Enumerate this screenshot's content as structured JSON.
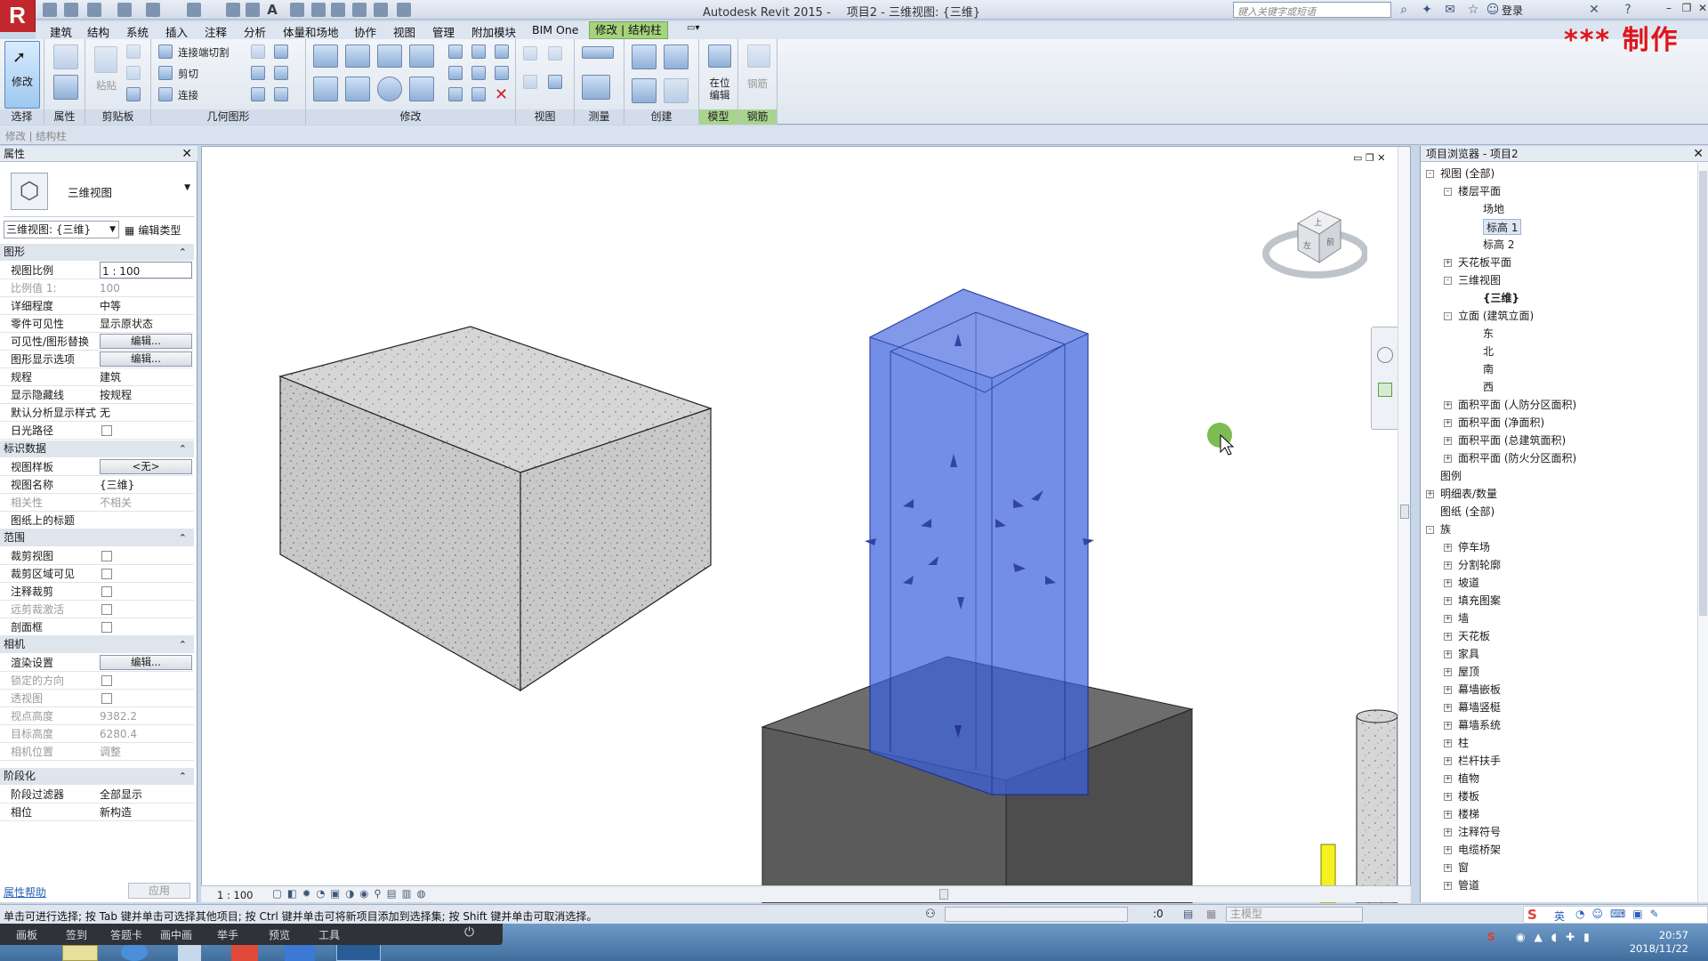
{
  "window": {
    "app_title": "Autodesk Revit 2015 -",
    "doc_title": "项目2 - 三维视图: {三维}",
    "search_placeholder": "键入关键字或短语",
    "login": "登录",
    "watermark": "*** 制作"
  },
  "menu": [
    "建筑",
    "结构",
    "系统",
    "插入",
    "注释",
    "分析",
    "体量和场地",
    "协作",
    "视图",
    "管理",
    "附加模块",
    "BIM One",
    "修改 | 结构柱"
  ],
  "ribbon": {
    "modify_label": "修改",
    "paste_label": "粘贴",
    "join_cut": "连接端切割",
    "cut": "剪切",
    "join": "连接",
    "inplace_label": "在位\n编辑",
    "rebar_label": "钢筋",
    "panels": [
      "选择",
      "属性",
      "剪贴板",
      "几何图形",
      "修改",
      "视图",
      "测量",
      "创建",
      "模型",
      "钢筋"
    ]
  },
  "optbar": "修改 | 结构柱",
  "properties": {
    "title": "属性",
    "type_name": "三维视图",
    "selector": "三维视图: {三维}",
    "edit_type": "编辑类型",
    "sections": {
      "graphics": "图形",
      "identity": "标识数据",
      "extents": "范围",
      "camera": "相机",
      "phasing": "阶段化"
    },
    "graphics_rows": [
      {
        "k": "视图比例",
        "v": "1 : 100"
      },
      {
        "k": "比例值 1:",
        "v": "100"
      },
      {
        "k": "详细程度",
        "v": "中等"
      },
      {
        "k": "零件可见性",
        "v": "显示原状态"
      },
      {
        "k": "可见性/图形替换",
        "v": "编辑..."
      },
      {
        "k": "图形显示选项",
        "v": "编辑..."
      },
      {
        "k": "规程",
        "v": "建筑"
      },
      {
        "k": "显示隐藏线",
        "v": "按规程"
      },
      {
        "k": "默认分析显示样式",
        "v": "无"
      },
      {
        "k": "日光路径",
        "v": ""
      }
    ],
    "identity_rows": [
      {
        "k": "视图样板",
        "v": "<无>"
      },
      {
        "k": "视图名称",
        "v": "{三维}"
      },
      {
        "k": "相关性",
        "v": "不相关"
      },
      {
        "k": "图纸上的标题",
        "v": ""
      }
    ],
    "extents_rows": [
      {
        "k": "裁剪视图",
        "v": ""
      },
      {
        "k": "裁剪区域可见",
        "v": ""
      },
      {
        "k": "注释裁剪",
        "v": ""
      },
      {
        "k": "远剪裁激活",
        "v": ""
      },
      {
        "k": "剖面框",
        "v": ""
      }
    ],
    "camera_rows": [
      {
        "k": "渲染设置",
        "v": "编辑..."
      },
      {
        "k": "锁定的方向",
        "v": ""
      },
      {
        "k": "透视图",
        "v": ""
      },
      {
        "k": "视点高度",
        "v": "9382.2"
      },
      {
        "k": "目标高度",
        "v": "6280.4"
      },
      {
        "k": "相机位置",
        "v": "调整"
      }
    ],
    "phasing_rows": [
      {
        "k": "阶段过滤器",
        "v": "全部显示"
      },
      {
        "k": "相位",
        "v": "新构造"
      }
    ],
    "help": "属性帮助",
    "apply": "应用"
  },
  "viewbar": {
    "scale": "1 : 100"
  },
  "viewcube": {
    "front": "前",
    "left": "左",
    "top": "上"
  },
  "browser": {
    "title": "项目浏览器 - 项目2",
    "items": [
      {
        "t": "视图 (全部)",
        "lvl": 0,
        "tog": "-"
      },
      {
        "t": "楼层平面",
        "lvl": 1,
        "tog": "-"
      },
      {
        "t": "场地",
        "lvl": 2,
        "tog": ""
      },
      {
        "t": "标高 1",
        "lvl": 2,
        "tog": "",
        "sel": true
      },
      {
        "t": "标高 2",
        "lvl": 2,
        "tog": ""
      },
      {
        "t": "天花板平面",
        "lvl": 1,
        "tog": "+"
      },
      {
        "t": "三维视图",
        "lvl": 1,
        "tog": "-"
      },
      {
        "t": "{三维}",
        "lvl": 2,
        "tog": "",
        "bold": true
      },
      {
        "t": "立面 (建筑立面)",
        "lvl": 1,
        "tog": "-"
      },
      {
        "t": "东",
        "lvl": 2,
        "tog": ""
      },
      {
        "t": "北",
        "lvl": 2,
        "tog": ""
      },
      {
        "t": "南",
        "lvl": 2,
        "tog": ""
      },
      {
        "t": "西",
        "lvl": 2,
        "tog": ""
      },
      {
        "t": "面积平面 (人防分区面积)",
        "lvl": 1,
        "tog": "+"
      },
      {
        "t": "面积平面 (净面积)",
        "lvl": 1,
        "tog": "+"
      },
      {
        "t": "面积平面 (总建筑面积)",
        "lvl": 1,
        "tog": "+"
      },
      {
        "t": "面积平面 (防火分区面积)",
        "lvl": 1,
        "tog": "+"
      },
      {
        "t": "图例",
        "lvl": 0,
        "tog": ""
      },
      {
        "t": "明细表/数量",
        "lvl": 0,
        "tog": "+"
      },
      {
        "t": "图纸 (全部)",
        "lvl": 0,
        "tog": ""
      },
      {
        "t": "族",
        "lvl": 0,
        "tog": "-"
      },
      {
        "t": "停车场",
        "lvl": 1,
        "tog": "+"
      },
      {
        "t": "分割轮廓",
        "lvl": 1,
        "tog": "+"
      },
      {
        "t": "坡道",
        "lvl": 1,
        "tog": "+"
      },
      {
        "t": "填充图案",
        "lvl": 1,
        "tog": "+"
      },
      {
        "t": "墙",
        "lvl": 1,
        "tog": "+"
      },
      {
        "t": "天花板",
        "lvl": 1,
        "tog": "+"
      },
      {
        "t": "家具",
        "lvl": 1,
        "tog": "+"
      },
      {
        "t": "屋顶",
        "lvl": 1,
        "tog": "+"
      },
      {
        "t": "幕墙嵌板",
        "lvl": 1,
        "tog": "+"
      },
      {
        "t": "幕墙竖梃",
        "lvl": 1,
        "tog": "+"
      },
      {
        "t": "幕墙系统",
        "lvl": 1,
        "tog": "+"
      },
      {
        "t": "柱",
        "lvl": 1,
        "tog": "+"
      },
      {
        "t": "栏杆扶手",
        "lvl": 1,
        "tog": "+"
      },
      {
        "t": "植物",
        "lvl": 1,
        "tog": "+"
      },
      {
        "t": "楼板",
        "lvl": 1,
        "tog": "+"
      },
      {
        "t": "楼梯",
        "lvl": 1,
        "tog": "+"
      },
      {
        "t": "注释符号",
        "lvl": 1,
        "tog": "+"
      },
      {
        "t": "电缆桥架",
        "lvl": 1,
        "tog": "+"
      },
      {
        "t": "窗",
        "lvl": 1,
        "tog": "+"
      },
      {
        "t": "管道",
        "lvl": 1,
        "tog": "+"
      }
    ]
  },
  "status": {
    "text": "单击可进行选择; 按 Tab 键并单击可选择其他项目; 按 Ctrl 键并单击可将新项目添加到选择集; 按 Shift 键并单击可取消选择。",
    "counter": ":0",
    "model": "主模型"
  },
  "dock": [
    "画板",
    "签到",
    "答题卡",
    "画中画",
    "举手",
    "预览",
    "工具"
  ],
  "clock": {
    "time": "20:57",
    "date": "2018/11/22"
  },
  "ime": "英",
  "colors": {
    "accent_green": "#a6d47e",
    "column_blue": "#4e6fd6",
    "brand_red": "#c1272d"
  }
}
